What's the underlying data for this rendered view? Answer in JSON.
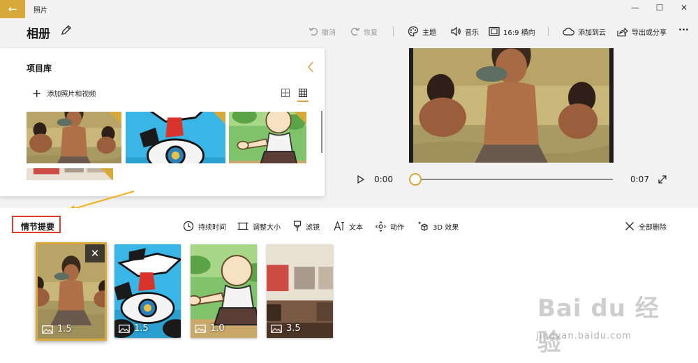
{
  "app": {
    "title": "照片"
  },
  "window": {
    "minimize": "—",
    "maximize": "☐",
    "close": "✕"
  },
  "toolbar": {
    "album_title": "相册",
    "undo": "撤消",
    "redo": "恢复",
    "theme": "主题",
    "music": "音乐",
    "aspect": "16:9 横向",
    "add_to_cloud": "添加到云",
    "export_share": "导出或分享",
    "more": "···"
  },
  "library": {
    "title": "项目库",
    "add_media": "添加照片和视频"
  },
  "preview": {
    "current_time": "0:00",
    "end_time": "0:07",
    "progress": 0
  },
  "storyboard": {
    "title": "情节提要",
    "tools": {
      "duration": "持续时间",
      "resize": "调整大小",
      "filter": "滤镜",
      "text": "文本",
      "motion": "动作",
      "effects3d": "3D 效果",
      "delete_all": "全部删除"
    },
    "clips": [
      {
        "duration": "1.5",
        "selected": true
      },
      {
        "duration": "1.5",
        "selected": false
      },
      {
        "duration": "1.0",
        "selected": false
      },
      {
        "duration": "3.5",
        "selected": false
      }
    ]
  },
  "watermark": {
    "main": "Bai  du 经验",
    "sub": "jingyan.baidu.com"
  },
  "colors": {
    "accent": "#d7a83a",
    "annotation_red": "#e23a2a",
    "annotation_arrow": "#f2b21c"
  }
}
